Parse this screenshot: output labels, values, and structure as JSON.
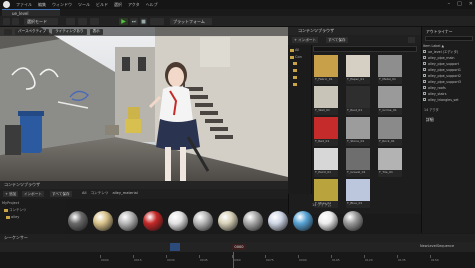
{
  "titlebar": {
    "doc_tab": "ue_level",
    "controls": [
      "–",
      "□",
      "✕"
    ]
  },
  "menu": [
    "ファイル",
    "編集",
    "ウィンドウ",
    "ツール",
    "ビルド",
    "選択",
    "アクタ",
    "ヘルプ"
  ],
  "toolbar": {
    "select_mode": "選択モード",
    "platforms": "プラットフォーム"
  },
  "viewport": {
    "chips": [
      "パースペクティブ",
      "ライティングあり",
      "表示"
    ]
  },
  "content_drawer": {
    "title": "コンテンツブラウザ",
    "add_label": "+ インポート",
    "save_label": "すべて保存",
    "tree": [
      "All",
      "Con",
      "",
      "",
      "",
      "",
      ""
    ],
    "tiles": [
      {
        "label": "T_Fabric_01",
        "color": "#c9a04a"
      },
      {
        "label": "T_Paper_01",
        "color": "#d6d0c4"
      },
      {
        "label": "T_Metal_01",
        "color": "#8e8e8e"
      },
      {
        "label": "T_Wall_01",
        "color": "#c8c4b8"
      },
      {
        "label": "T_Rust_01",
        "color": "#2e2e2e"
      },
      {
        "label": "T_Grime_01",
        "color": "#9a9a9a"
      },
      {
        "label": "T_Red_01",
        "color": "#c62b2b"
      },
      {
        "label": "T_Stone_01",
        "color": "#9c9c9c"
      },
      {
        "label": "T_Rock_01",
        "color": "#8a8a8a"
      },
      {
        "label": "T_Paint_01",
        "color": "#d7d7d7"
      },
      {
        "label": "T_Gravel_01",
        "color": "#6e6e6e"
      },
      {
        "label": "T_Tile_01",
        "color": "#b3b3b3"
      },
      {
        "label": "T_Moss_01",
        "color": "#b8a33c"
      },
      {
        "label": "T_Blue_01",
        "color": "#bcc6dc"
      }
    ],
    "count": "14 アイテム"
  },
  "outliner": {
    "title": "アウトライナー",
    "rows": [
      "Item Label ▲",
      "ue_level (エディタ)",
      "alley_pipe_main",
      "alley_pipe_support",
      "alley_pipe_support1",
      "alley_pipe_support2",
      "alley_pipe_support3",
      "alley_roofs",
      "alley_stairs",
      "alley_triangles_set"
    ],
    "count": "14 アクタ"
  },
  "details": {
    "title": "詳細"
  },
  "content_browser": {
    "tab": "コンテンツブラウザ",
    "add": "+ 追加",
    "import": "インポート",
    "save_all": "すべて保存",
    "path": [
      "All",
      "コンテンツ",
      "alley_material"
    ],
    "tree_root": "MyProject",
    "tree_items": [
      "コンテンツ",
      "alley"
    ],
    "spheres": [
      "#6a6a6a",
      "#d9c28a",
      "#b8b8b8",
      "#c62828",
      "#e2e2e2",
      "#b7b7b7",
      "#d8d1b8",
      "#a9a9a9",
      "#cfd6e6",
      "#58a4d6",
      "#ececec",
      "#9a9a9a"
    ]
  },
  "sequencer": {
    "tab": "シーケンサー",
    "timecode": "0000",
    "ticks": [
      "0000",
      "0015",
      "0030",
      "0045",
      "0060",
      "0075",
      "0090",
      "0105",
      "0120",
      "0135",
      "0150"
    ],
    "sequence_name": "NewLevelSequence"
  }
}
